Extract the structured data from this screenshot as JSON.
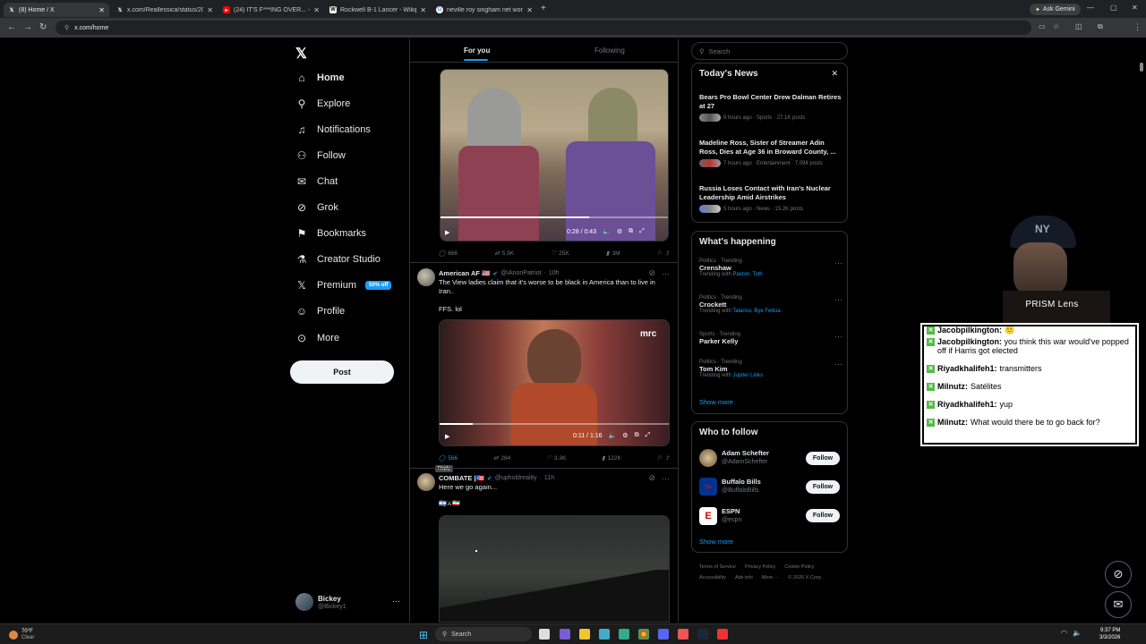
{
  "browser": {
    "tabs": [
      {
        "label": "(8) Home / X",
        "active": true
      },
      {
        "label": "x.com/Reallessica/status/2028...",
        "active": false
      },
      {
        "label": "(24) IT'S F***ING OVER... - YouTube",
        "active": false
      },
      {
        "label": "Rockwell B-1 Lancer - Wikipedia",
        "active": false
      },
      {
        "label": "neville roy singham net worth",
        "active": false
      }
    ],
    "url": "x.com/home",
    "ask_gemini": "Ask Gemini"
  },
  "nav": {
    "items": [
      {
        "label": "Home",
        "icon": "home-icon"
      },
      {
        "label": "Explore",
        "icon": "search-icon"
      },
      {
        "label": "Notifications",
        "icon": "bell-icon"
      },
      {
        "label": "Follow",
        "icon": "person-add-icon"
      },
      {
        "label": "Chat",
        "icon": "mail-icon"
      },
      {
        "label": "Grok",
        "icon": "grok-icon"
      },
      {
        "label": "Bookmarks",
        "icon": "bookmark-icon"
      },
      {
        "label": "Creator Studio",
        "icon": "flask-icon"
      },
      {
        "label": "Premium",
        "icon": "x-icon"
      },
      {
        "label": "Profile",
        "icon": "person-icon"
      },
      {
        "label": "More",
        "icon": "more-circle-icon"
      }
    ],
    "premium_badge": "50% off",
    "post_label": "Post",
    "account": {
      "name": "Bickey",
      "handle": "@Bickey1"
    }
  },
  "feed": {
    "tabs": [
      "For you",
      "Following"
    ],
    "tweet1": {
      "time": "0:28 / 0:43",
      "actions": {
        "replies": "666",
        "reposts": "5.9K",
        "likes": "25K",
        "views": "3M"
      }
    },
    "tweet2": {
      "name": "American AF 🇺🇸",
      "handle": "@iAnonPatriot",
      "age": "10h",
      "text": "The View ladies claim that it's worse to be black in America than to live in Iran..",
      "text2": "FFS. lol",
      "time": "0:11 / 1:16",
      "watermark": "mrc",
      "actions": {
        "replies": "566",
        "reposts": "284",
        "likes": "3.3K",
        "views": "122K"
      },
      "tooltip": "Reply"
    },
    "tweet3": {
      "name": "COMBATE |🇵🇷",
      "handle": "@upholdreality",
      "age": "11h",
      "text": "Here we go again...",
      "flags": "🇮🇱⚔🇮🇷"
    }
  },
  "sidebar": {
    "search_placeholder": "Search",
    "news": {
      "title": "Today's News",
      "items": [
        {
          "headline": "Bears Pro Bowl Center Drew Dalman Retires at 27",
          "meta": "9 hours ago · Sports · 27.1K posts"
        },
        {
          "headline": "Madeline Ross, Sister of Streamer Adin Ross, Dies at Age 36 in Broward County, ...",
          "meta": "7 hours ago · Entertainment · 7,094 posts"
        },
        {
          "headline": "Russia Loses Contact with Iran's Nuclear Leadership Amid Airstrikes",
          "meta": "5 hours ago · News · 15.2K posts"
        }
      ]
    },
    "happening": {
      "title": "What's happening",
      "trends": [
        {
          "category": "Politics · Trending",
          "name": "Crenshaw",
          "with_label": "Trending with",
          "with": "Paxton, Toth"
        },
        {
          "category": "Politics · Trending",
          "name": "Crockett",
          "with_label": "Trending with",
          "with": "Talarico, Bye Felicia"
        },
        {
          "category": "Sports · Trending",
          "name": "Parker Kelly",
          "with_label": "",
          "with": ""
        },
        {
          "category": "Politics · Trending",
          "name": "Tom Kim",
          "with_label": "Trending with",
          "with": "Jupiter Links"
        }
      ],
      "show_more": "Show more"
    },
    "who_to_follow": {
      "title": "Who to follow",
      "accounts": [
        {
          "name": "Adam Schefter",
          "handle": "@AdamSchefter",
          "button": "Follow"
        },
        {
          "name": "Buffalo Bills",
          "handle": "@BuffaloBills",
          "button": "Follow"
        },
        {
          "name": "ESPN",
          "handle": "@espn",
          "button": "Follow"
        }
      ],
      "show_more": "Show more"
    },
    "footer": [
      "Terms of Service",
      "Privacy Policy",
      "Cookie Policy",
      "Accessibility",
      "Ads info",
      "More ···",
      "© 2026 X Corp."
    ]
  },
  "stream": {
    "webcam_label": "PRISM Lens",
    "chat": [
      {
        "user": "Jacobpilkington:",
        "msg": "🙁"
      },
      {
        "user": "Jacobpilkington:",
        "msg": "you think this war would've popped off if Harris got elected"
      },
      {
        "user": "Riyadkhalifeh1:",
        "msg": "transmitters"
      },
      {
        "user": "Milnutz:",
        "msg": "Satélites"
      },
      {
        "user": "Riyadkhalifeh1:",
        "msg": "yup"
      },
      {
        "user": "Milnutz:",
        "msg": "What would there be to go back for?"
      }
    ]
  },
  "taskbar": {
    "weather_temp": "70°F",
    "weather_desc": "Clear",
    "search": "Search",
    "time": "9:37 PM",
    "date": "3/3/2026"
  }
}
